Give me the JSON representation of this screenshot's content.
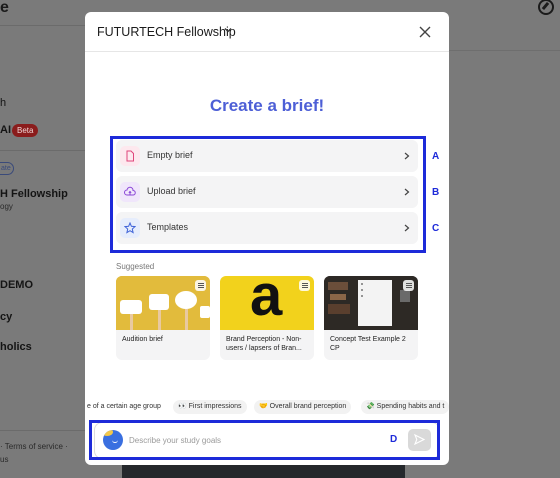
{
  "background": {
    "app_letter": "e",
    "sidebar_lines": [
      {
        "text": "h",
        "bold": false
      },
      {
        "text": "AI",
        "bold": true
      },
      {
        "text": "ate",
        "bold": false
      },
      {
        "text": "H Fellowship",
        "bold": true
      },
      {
        "text": "ogy",
        "bold": false
      },
      {
        "text": "DEMO",
        "bold": true
      },
      {
        "text": "cy",
        "bold": true
      },
      {
        "text": "holics",
        "bold": true
      }
    ],
    "beta_badge": "Beta",
    "footer_terms": "· Terms of service ·",
    "footer_us": "us"
  },
  "modal": {
    "title": "FUTURTECH Fellowship",
    "heading": "Create a brief!",
    "options": [
      {
        "label": "Empty brief",
        "icon": "document-icon",
        "icon_bg": "#fde8ee",
        "icon_color": "#e0457b"
      },
      {
        "label": "Upload brief",
        "icon": "cloud-upload-icon",
        "icon_bg": "#f0e6fb",
        "icon_color": "#8a46d6"
      },
      {
        "label": "Templates",
        "icon": "star-icon",
        "icon_bg": "#e6edfc",
        "icon_color": "#3f63d8"
      }
    ],
    "suggested_label": "Suggested",
    "cards": [
      {
        "text": "Audition brief"
      },
      {
        "text": "Brand Perception - Non-users / lapsers of Bran..."
      },
      {
        "text": "Concept Test Example 2 CP"
      }
    ],
    "card_b_glyph": "a",
    "chips": [
      {
        "text": "e of a certain age group"
      },
      {
        "text": "👀 First impressions"
      },
      {
        "text": "🤝 Overall brand perception"
      },
      {
        "text": "💸 Spending habits and t"
      }
    ],
    "input_placeholder": "Describe your study goals"
  },
  "annotations": {
    "letters": [
      "A",
      "B",
      "C",
      "D"
    ],
    "color": "#1d2ad9"
  },
  "colors": {
    "heading": "#4d5fd6",
    "overlay": "#7a7a7a"
  }
}
